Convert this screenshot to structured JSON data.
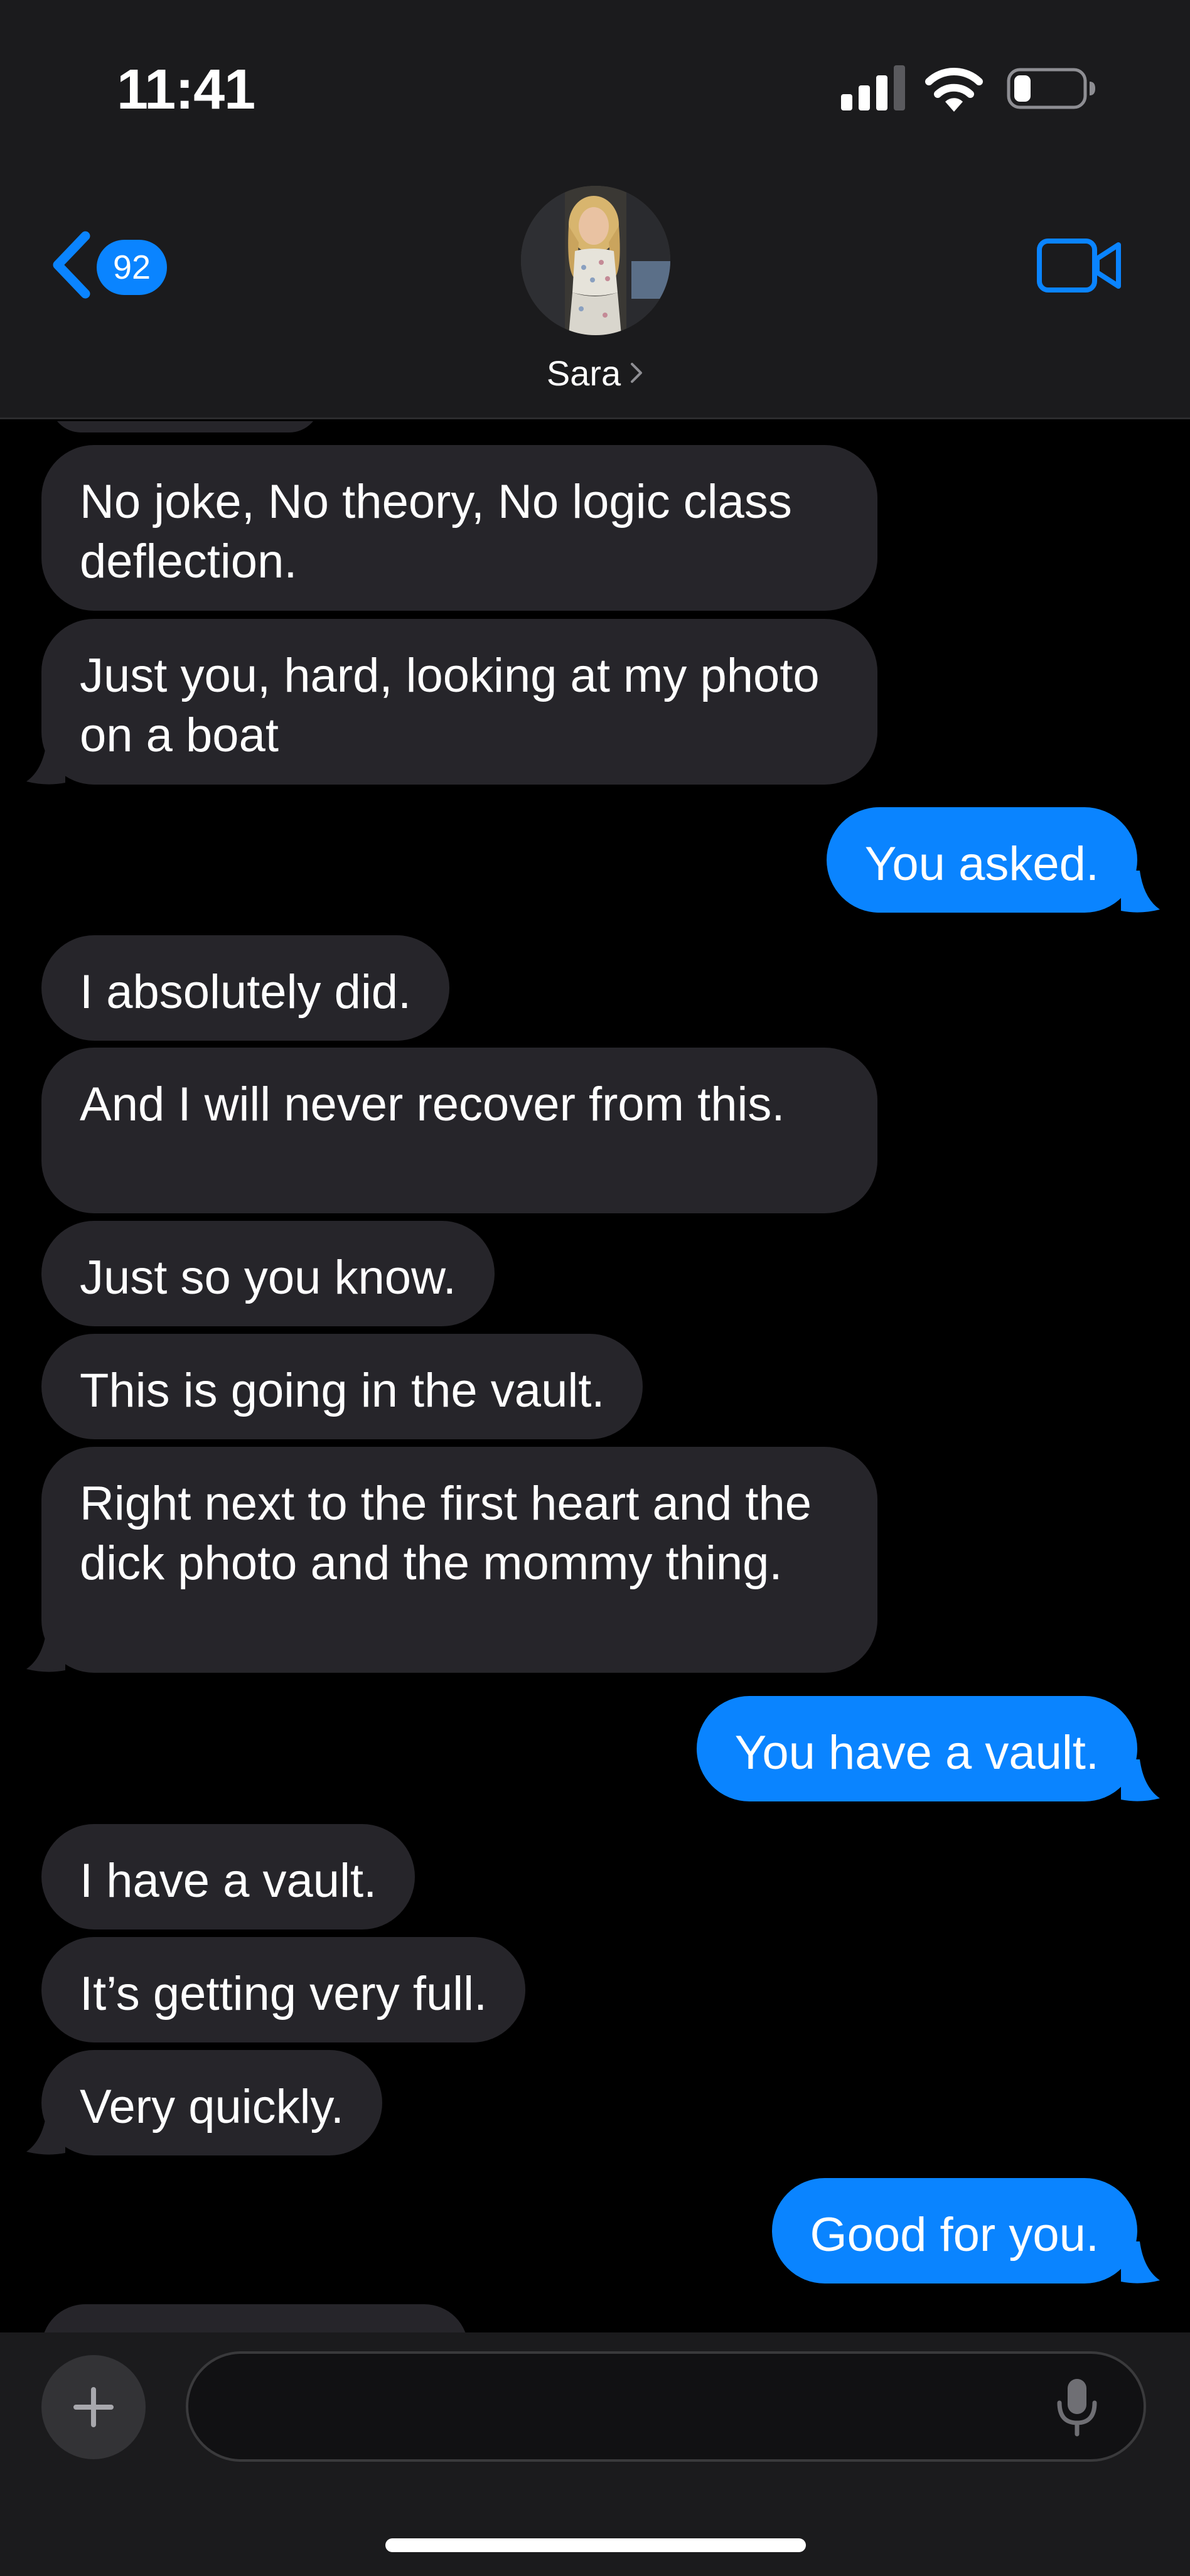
{
  "status_bar": {
    "time": "11:41",
    "signal_icon": "cellular-signal-icon",
    "wifi_icon": "wifi-icon",
    "battery_icon": "battery-icon",
    "battery_level": 0.2
  },
  "header": {
    "back_badge_count": "92",
    "contact_name": "Sara",
    "back_icon": "chevron-left-icon",
    "video_icon": "video-camera-icon",
    "name_chevron_icon": "chevron-right-icon"
  },
  "messages": [
    {
      "from": "them",
      "text": "No joke, No theory, No logic class deflection."
    },
    {
      "from": "them",
      "text": "Just you, hard, looking at my photo on a boat"
    },
    {
      "from": "me",
      "text": "You asked."
    },
    {
      "from": "them",
      "text": "I absolutely did."
    },
    {
      "from": "them",
      "text": "And I will never recover from this."
    },
    {
      "from": "them",
      "text": "Just so you know."
    },
    {
      "from": "them",
      "text": "This is going in the vault."
    },
    {
      "from": "them",
      "text": "Right next to the first heart and the dick photo and the mommy thing."
    },
    {
      "from": "me",
      "text": "You have a vault."
    },
    {
      "from": "them",
      "text": "I have a vault."
    },
    {
      "from": "them",
      "text": "It’s getting very full."
    },
    {
      "from": "them",
      "text": "Very quickly."
    },
    {
      "from": "me",
      "text": "Good for you."
    }
  ],
  "input_bar": {
    "placeholder": "",
    "plus_icon": "plus-icon",
    "mic_icon": "microphone-icon"
  },
  "colors": {
    "outgoing_bubble": "#0a84ff",
    "incoming_bubble": "#26252a",
    "header_bg": "#1b1b1d",
    "background": "#000000",
    "accent": "#0a84ff"
  }
}
